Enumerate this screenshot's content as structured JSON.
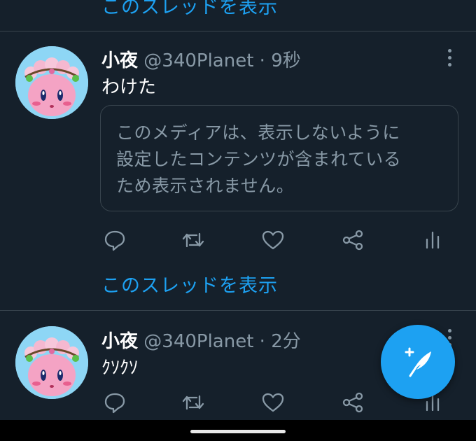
{
  "thread_link_top": "このスレッドを表示",
  "thread_link_mid": "このスレッドを表示",
  "tweets": [
    {
      "name": "小夜",
      "handle": "@340Planet · 9秒",
      "text": "わけた",
      "media_notice": [
        "このメディアは、表示しないように",
        "設定したコンテンツが含まれている",
        "ため表示されません。"
      ]
    },
    {
      "name": "小夜",
      "handle": "@340Planet · 2分",
      "text": "ｸｿｸｿ"
    }
  ],
  "icons": {
    "reply": "reply-icon",
    "retweet": "retweet-icon",
    "like": "heart-icon",
    "share": "share-icon",
    "analytics": "analytics-icon",
    "more": "more-vertical-icon",
    "compose": "compose-tweet-icon"
  },
  "colors": {
    "background": "#15202b",
    "accent": "#1da1f2",
    "secondary_text": "#8899a6",
    "divider": "#38444d"
  }
}
